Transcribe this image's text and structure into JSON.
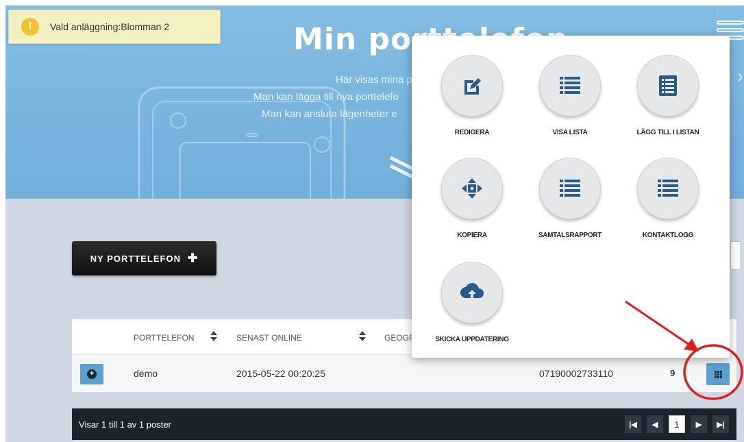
{
  "notification": {
    "text": "Vald anläggning:Blomman 2"
  },
  "hero": {
    "title": "Min porttelefon",
    "line1": "Här visas mina p",
    "line2": "Man kan lägga till nya porttelefo",
    "line3": "Man kan ansluta lägenheter e"
  },
  "toolbar": {
    "new_button": "NY PORTTELEFON",
    "new_button_icon": "plus-icon"
  },
  "table": {
    "columns": [
      "PORTTELEFON",
      "SENAST ONLINE",
      "GEOGR"
    ],
    "rows": [
      {
        "name": "demo",
        "last_online": "2015-05-22 00:20:25",
        "number": "07190002733110",
        "count": "9"
      }
    ]
  },
  "footer": {
    "info": "Visar 1 till 1 av 1 poster",
    "current_page": "1"
  },
  "actions_menu": [
    {
      "label": "REDIGERA",
      "icon": "edit-icon"
    },
    {
      "label": "VISA LISTA",
      "icon": "list-icon"
    },
    {
      "label": "LÄGG TILL I LISTAN",
      "icon": "list-add-icon"
    },
    {
      "label": "KOPIERA",
      "icon": "move-icon"
    },
    {
      "label": "SAMTALSRAPPORT",
      "icon": "list-icon"
    },
    {
      "label": "KONTAKTLOGG",
      "icon": "list-icon"
    },
    {
      "label": "SKICKA UPPDATERING",
      "icon": "cloud-upload-icon"
    }
  ],
  "colors": {
    "accent": "#5ba0d0",
    "icon": "#2c5b8a",
    "hero": "#7db7e0",
    "callout": "#e01e1e"
  }
}
